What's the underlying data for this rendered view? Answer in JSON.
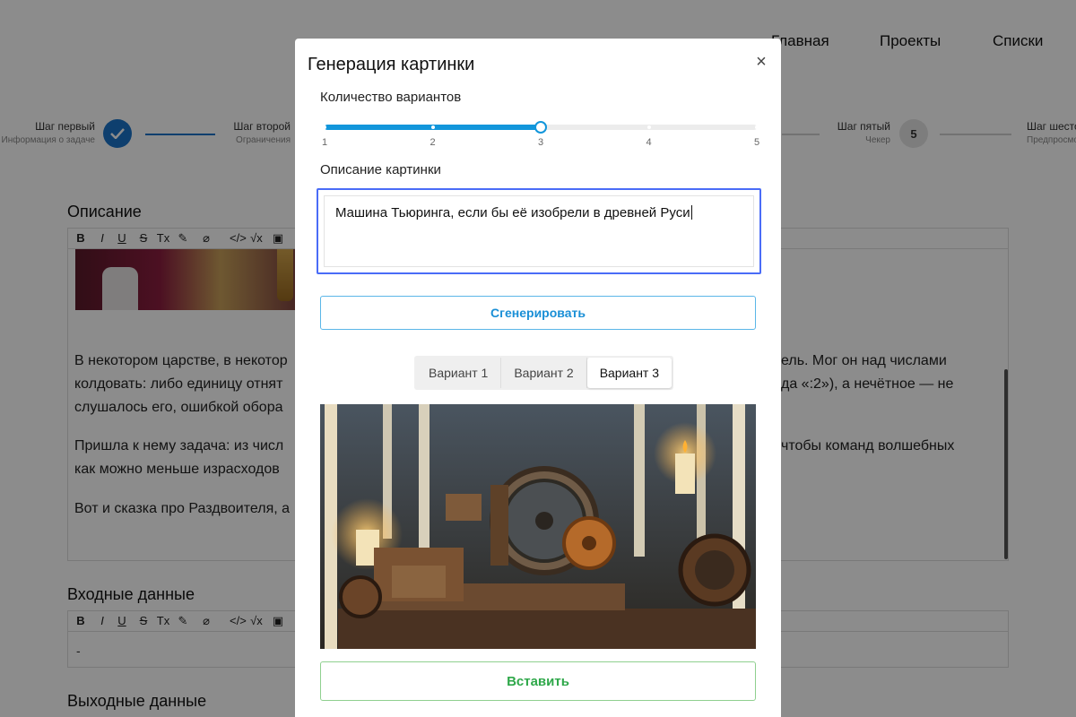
{
  "nav": {
    "home": "Главная",
    "projects": "Проекты",
    "lists": "Списки"
  },
  "steps": [
    {
      "title": "Шаг первый",
      "subtitle": "Информация о задаче",
      "state": "done"
    },
    {
      "title": "Шаг второй",
      "subtitle": "Ограничения",
      "state": "current"
    },
    {
      "title": "Шаг пятый",
      "subtitle": "Чекер",
      "state": "todo",
      "number": "5"
    },
    {
      "title": "Шаг шестой",
      "subtitle": "Предпросмотр",
      "state": "todo"
    }
  ],
  "page": {
    "description_title": "Описание",
    "input_title": "Входные данные",
    "output_title": "Выходные данные",
    "para1_line1_left": "В некотором царстве, в некотор",
    "para1_line1_right": "ель. Мог он над числами",
    "para1_line2_left": "колдовать: либо единицу отнят",
    "para1_line2_right": "да «:2»), а нечётное — не",
    "para1_line3_left": "слушалось его, ошибкой обора",
    "para2_line1_left": "Пришла к нему задача: из числ",
    "para2_line1_right": "чтобы команд волшебных",
    "para2_line2_left": "как можно меньше израсходов",
    "para3_left": "Вот и сказка про Раздвоителя, а",
    "input_value": "-"
  },
  "toolbar_icons": [
    "bold-icon",
    "italic-icon",
    "underline-icon",
    "strikethrough-icon",
    "clear-format-icon",
    "link-icon",
    "unlink-icon",
    "code-icon",
    "formula-icon",
    "image-icon"
  ],
  "toolbar_glyphs": [
    "B",
    "I",
    "U",
    "S",
    "Tx",
    "✎",
    "⌀",
    "</>",
    "√x",
    "▣"
  ],
  "modal": {
    "title": "Генерация картинки",
    "close": "×",
    "variants_label": "Количество вариантов",
    "slider": {
      "min": 1,
      "max": 5,
      "value": 3,
      "ticks": [
        "1",
        "2",
        "3",
        "4",
        "5"
      ]
    },
    "description_label": "Описание картинки",
    "description_value": "Машина Тьюринга, если бы её изобрели в древней Руси",
    "generate_label": "Сгенерировать",
    "tabs": [
      "Вариант 1",
      "Вариант 2",
      "Вариант 3"
    ],
    "active_tab": 2,
    "insert_label": "Вставить"
  },
  "colors": {
    "accent": "#1296db",
    "focus": "#4a6cf7",
    "insert": "#2fa84a",
    "step_done": "#1a73c8"
  }
}
